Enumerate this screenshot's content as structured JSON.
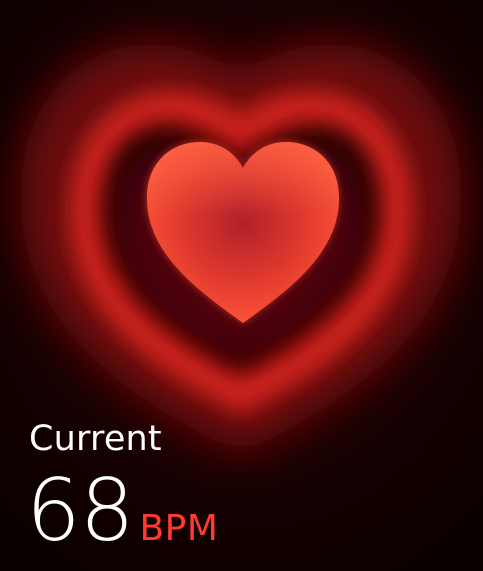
{
  "heart_rate": {
    "label": "Current",
    "value": "68",
    "unit": "BPM"
  },
  "icons": {
    "heart": "heart-icon"
  },
  "colors": {
    "heart": "#ff3b30",
    "unit": "#ff3b30",
    "background": "#000000"
  }
}
